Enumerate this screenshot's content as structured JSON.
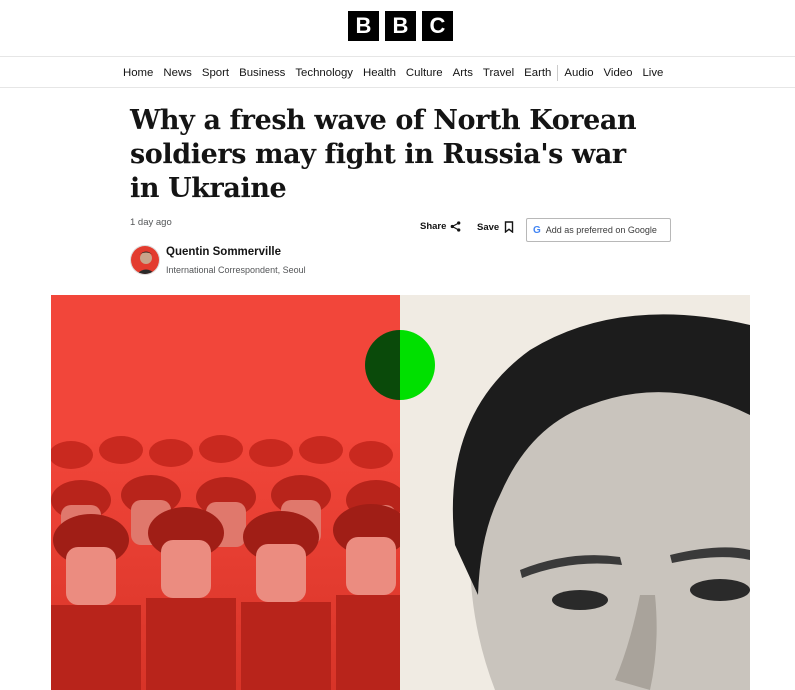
{
  "header": {
    "logo_letters": [
      "B",
      "B",
      "C"
    ]
  },
  "nav": {
    "items": [
      {
        "label": "Home",
        "key": "home"
      },
      {
        "label": "News",
        "key": "news"
      },
      {
        "label": "Sport",
        "key": "sport"
      },
      {
        "label": "Business",
        "key": "business"
      },
      {
        "label": "Technology",
        "key": "technology"
      },
      {
        "label": "Health",
        "key": "health"
      },
      {
        "label": "Culture",
        "key": "culture"
      },
      {
        "label": "Arts",
        "key": "arts"
      },
      {
        "label": "Travel",
        "key": "travel"
      },
      {
        "label": "Earth",
        "key": "earth"
      },
      {
        "label": "Audio",
        "key": "audio"
      },
      {
        "label": "Video",
        "key": "video"
      },
      {
        "label": "Live",
        "key": "live"
      }
    ]
  },
  "article": {
    "headline": "Why a fresh wave of North Korean soldiers may fight in Russia's war in Ukraine",
    "timestamp": "1 day ago",
    "share_label": "Share",
    "save_label": "Save",
    "google_label": "Add as preferred on Google",
    "author": {
      "name": "Quentin Sommerville",
      "role": "International Correspondent, Seoul"
    }
  },
  "colors": {
    "hero_left_bg": "#f2463a",
    "hero_right_bg": "#f0ebe3",
    "circle_dark": "#0a4a0a",
    "circle_bright": "#00e000"
  },
  "icons": {
    "share": "share-icon",
    "save": "bookmark-icon",
    "google": "google-g-icon"
  }
}
